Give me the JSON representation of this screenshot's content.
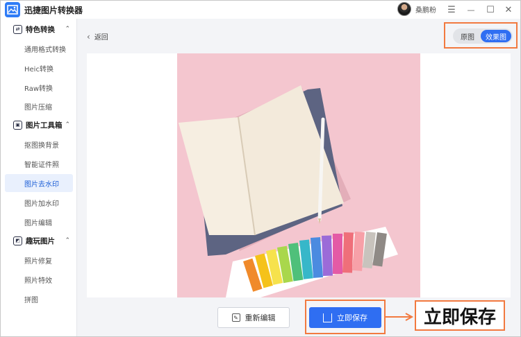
{
  "app": {
    "title": "迅捷图片转换器"
  },
  "user": {
    "name": "桑鹏粉"
  },
  "window_controls": {
    "menu": "☰",
    "minimize": "—",
    "maximize": "☐",
    "close": "✕"
  },
  "sidebar": {
    "sections": [
      {
        "label": "特色转换",
        "icon": "convert-icon",
        "items": [
          "通用格式转换",
          "Heic转换",
          "Raw转换",
          "图片压缩"
        ]
      },
      {
        "label": "图片工具箱",
        "icon": "toolbox-icon",
        "items": [
          "抠图换背景",
          "智能证件照",
          "图片去水印",
          "图片加水印",
          "图片编辑"
        ]
      },
      {
        "label": "趣玩图片",
        "icon": "fun-image-icon",
        "items": [
          "照片修复",
          "照片特效",
          "拼图"
        ]
      }
    ],
    "active_item": "图片去水印"
  },
  "main": {
    "back_label": "返回",
    "view_toggle": {
      "original": "原图",
      "effect": "效果图",
      "selected": "效果图"
    },
    "actions": {
      "re_edit": "重新编辑",
      "save": "立即保存"
    },
    "callout": "立即保存"
  },
  "colors": {
    "accent": "#2f6ef2",
    "highlight": "#f2793f",
    "photo_bg": "#f4c6cf"
  }
}
